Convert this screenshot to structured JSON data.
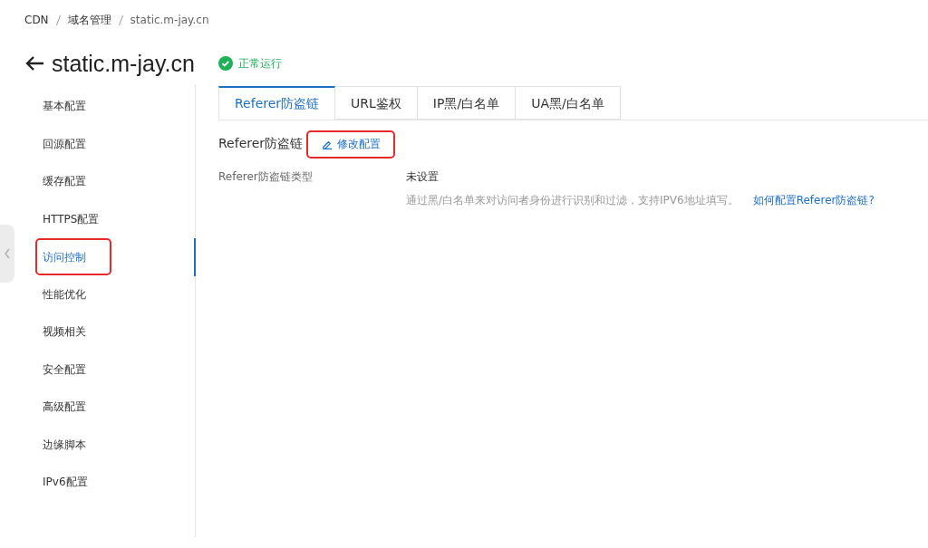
{
  "breadcrumb": [
    "CDN",
    "域名管理",
    "static.m-jay.cn"
  ],
  "header": {
    "title": "static.m-jay.cn",
    "status": "正常运行"
  },
  "sidebar": {
    "items": [
      {
        "label": "基本配置",
        "selected": false,
        "highlighted": false
      },
      {
        "label": "回源配置",
        "selected": false,
        "highlighted": false
      },
      {
        "label": "缓存配置",
        "selected": false,
        "highlighted": false
      },
      {
        "label": "HTTPS配置",
        "selected": false,
        "highlighted": false
      },
      {
        "label": "访问控制",
        "selected": true,
        "highlighted": true
      },
      {
        "label": "性能优化",
        "selected": false,
        "highlighted": false
      },
      {
        "label": "视频相关",
        "selected": false,
        "highlighted": false
      },
      {
        "label": "安全配置",
        "selected": false,
        "highlighted": false
      },
      {
        "label": "高级配置",
        "selected": false,
        "highlighted": false
      },
      {
        "label": "边缘脚本",
        "selected": false,
        "highlighted": false
      },
      {
        "label": "IPv6配置",
        "selected": false,
        "highlighted": false
      }
    ]
  },
  "tabs": [
    {
      "label": "Referer防盗链",
      "selected": true
    },
    {
      "label": "URL鉴权",
      "selected": false
    },
    {
      "label": "IP黑/白名单",
      "selected": false
    },
    {
      "label": "UA黑/白名单",
      "selected": false
    }
  ],
  "section": {
    "title": "Referer防盗链",
    "edit_link": {
      "label": "修改配置",
      "highlighted": true
    }
  },
  "fields": [
    {
      "label": "Referer防盗链类型",
      "value": "未设置",
      "hint": "通过黑/白名单来对访问者身份进行识别和过滤，支持IPV6地址填写。",
      "help_link": "如何配置Referer防盗链?"
    }
  ]
}
